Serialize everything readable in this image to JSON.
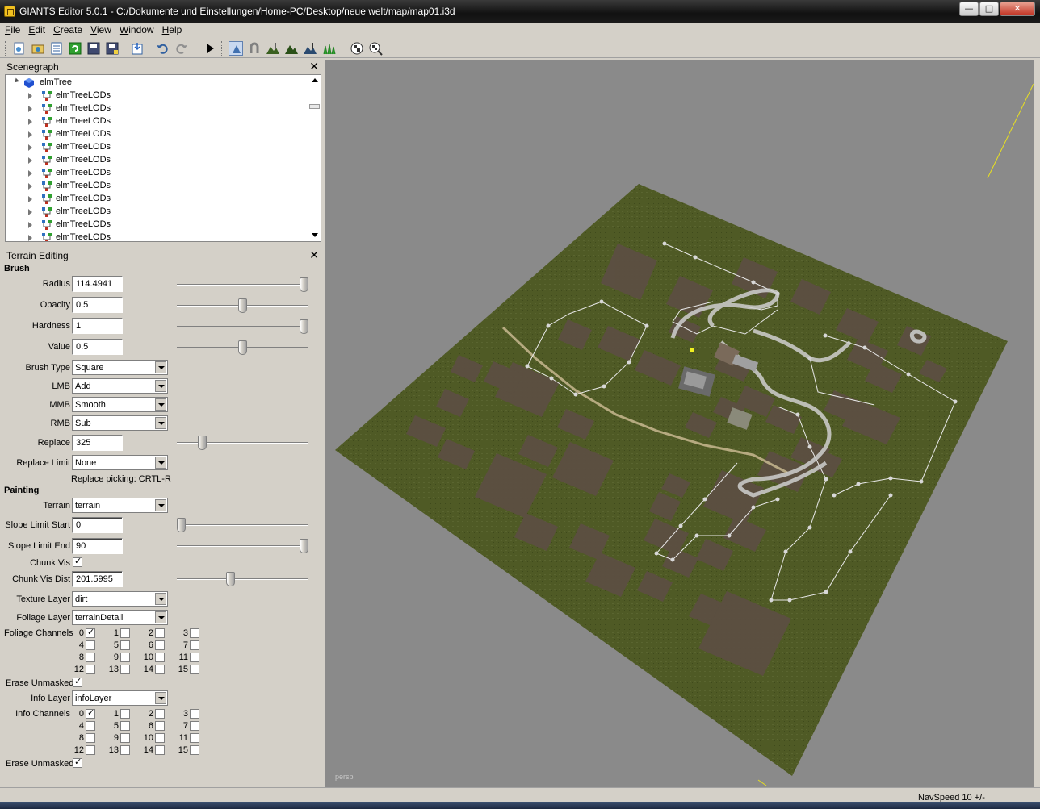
{
  "window": {
    "title": "GIANTS Editor 5.0.1 - C:/Dokumente und Einstellungen/Home-PC/Desktop/neue welt/map/map01.i3d"
  },
  "menu": [
    "File",
    "Edit",
    "Create",
    "View",
    "Window",
    "Help"
  ],
  "scenegraph": {
    "title": "Scenegraph",
    "root": "elmTree",
    "children": [
      "elmTreeLODs",
      "elmTreeLODs",
      "elmTreeLODs",
      "elmTreeLODs",
      "elmTreeLODs",
      "elmTreeLODs",
      "elmTreeLODs",
      "elmTreeLODs",
      "elmTreeLODs",
      "elmTreeLODs",
      "elmTreeLODs",
      "elmTreeLODs"
    ]
  },
  "terrain": {
    "title": "Terrain Editing",
    "brush": {
      "header": "Brush",
      "radius": {
        "label": "Radius",
        "value": "114.4941",
        "slider_fraction": 1.0
      },
      "opacity": {
        "label": "Opacity",
        "value": "0.5",
        "slider_fraction": 0.5
      },
      "hardness": {
        "label": "Hardness",
        "value": "1",
        "slider_fraction": 1.0
      },
      "value": {
        "label": "Value",
        "value": "0.5",
        "slider_fraction": 0.5
      },
      "brush_type": {
        "label": "Brush Type",
        "value": "Square"
      },
      "lmb": {
        "label": "LMB",
        "value": "Add"
      },
      "mmb": {
        "label": "MMB",
        "value": "Smooth"
      },
      "rmb": {
        "label": "RMB",
        "value": "Sub"
      },
      "replace": {
        "label": "Replace",
        "value": "325",
        "slider_fraction": 0.17
      },
      "replace_limit": {
        "label": "Replace Limit",
        "value": "None"
      },
      "replace_hint": "Replace picking: CRTL-R"
    },
    "painting": {
      "header": "Painting",
      "terrain": {
        "label": "Terrain",
        "value": "terrain"
      },
      "slope_start": {
        "label": "Slope Limit Start",
        "value": "0",
        "slider_fraction": 0.0
      },
      "slope_end": {
        "label": "Slope Limit End",
        "value": "90",
        "slider_fraction": 1.0
      },
      "chunk_vis": {
        "label": "Chunk Vis",
        "checked": true
      },
      "chunk_vis_dist": {
        "label": "Chunk Vis Dist",
        "value": "201.5995",
        "slider_fraction": 0.4
      },
      "texture_layer": {
        "label": "Texture Layer",
        "value": "dirt"
      },
      "foliage_layer": {
        "label": "Foliage Layer",
        "value": "terrainDetail"
      },
      "foliage_channels_label": "Foliage Channels",
      "foliage_channels_checked": [
        0
      ],
      "erase_unmasked_1": {
        "label": "Erase Unmasked",
        "checked": true
      },
      "info_layer": {
        "label": "Info Layer",
        "value": "infoLayer"
      },
      "info_channels_label": "Info Channels",
      "info_channels_checked": [
        0
      ],
      "erase_unmasked_2": {
        "label": "Erase Unmasked",
        "checked": true
      },
      "channel_numbers": [
        "0",
        "1",
        "2",
        "3",
        "4",
        "5",
        "6",
        "7",
        "8",
        "9",
        "10",
        "11",
        "12",
        "13",
        "14",
        "15"
      ]
    }
  },
  "viewport": {
    "camera_label": "persp",
    "terrain_color": "#4f5a25",
    "field_color": "#5c4f42",
    "background_color": "#8a8a8a"
  },
  "status": {
    "navspeed": "NavSpeed 10 +/-"
  }
}
